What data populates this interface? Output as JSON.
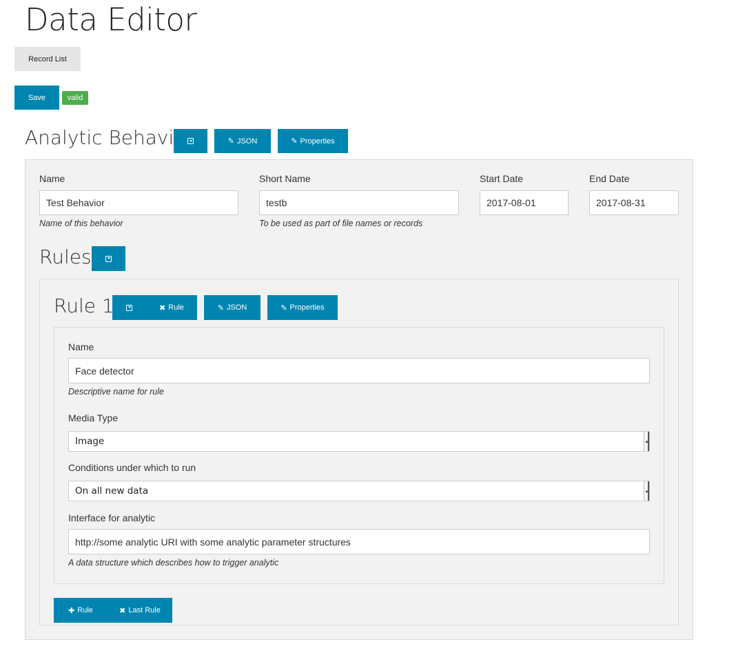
{
  "page": {
    "title": "Data Editor"
  },
  "toolbar": {
    "record_list_label": "Record List",
    "save_label": "Save",
    "valid_badge": "valid"
  },
  "behavior": {
    "heading": "Analytic Behavior",
    "json_label": "JSON",
    "properties_label": "Properties",
    "fields": {
      "name": {
        "label": "Name",
        "value": "Test Behavior",
        "help": "Name of this behavior"
      },
      "short_name": {
        "label": "Short Name",
        "value": "testb",
        "help": "To be used as part of file names or records"
      },
      "start_date": {
        "label": "Start Date",
        "value": "2017-08-01"
      },
      "end_date": {
        "label": "End Date",
        "value": "2017-08-31"
      }
    }
  },
  "rules": {
    "heading": "Rules",
    "add_rule_label": "Rule",
    "remove_last_label": "Last Rule",
    "items": [
      {
        "heading": "Rule 1",
        "remove_label": "Rule",
        "json_label": "JSON",
        "properties_label": "Properties",
        "name": {
          "label": "Name",
          "value": "Face detector",
          "help": "Descriptive name for rule"
        },
        "media_type": {
          "label": "Media Type",
          "value": "Image"
        },
        "conditions": {
          "label": "Conditions under which to run",
          "value": "On all new data"
        },
        "interface": {
          "label": "Interface for analytic",
          "value": "http://some analytic URI with some analytic parameter structures",
          "help": "A data structure which describes how to trigger analytic"
        }
      }
    ]
  },
  "colors": {
    "primary": "#0085b0",
    "success": "#4cae4c",
    "panel": "#f2f2f2",
    "secondary": "#e5e5e5"
  },
  "icons": {
    "collapse": "collapse-icon",
    "pencil": "pencil-icon",
    "remove": "x-icon",
    "add": "plus-icon"
  }
}
